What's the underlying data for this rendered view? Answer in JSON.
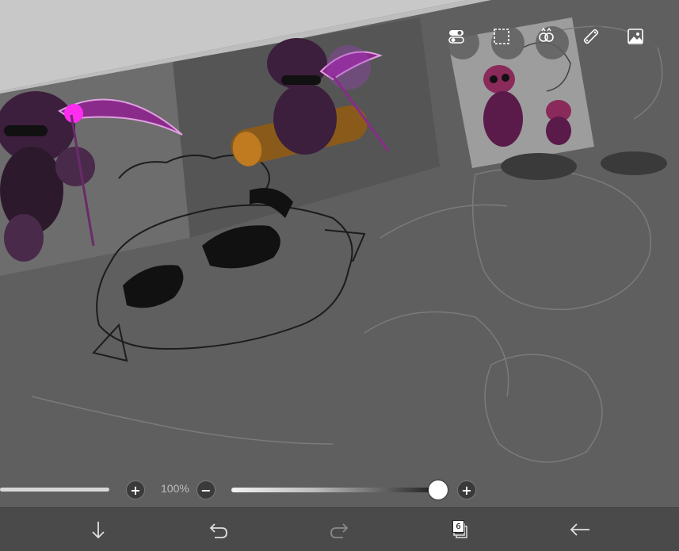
{
  "zoom": {
    "label": "100%"
  },
  "layers": {
    "count": "6"
  },
  "colors": {
    "toolbar_bg": "#4a4a4a",
    "canvas_bg": "#5e5e5e",
    "outer_bg": "#c8c8c8",
    "accent_purple": "#8a2a8a"
  },
  "toolbar_top": {
    "icons": [
      "toggle-icon",
      "selection-icon",
      "filter-icon",
      "ruler-icon",
      "image-icon"
    ]
  },
  "bottom_bar": {
    "icons": [
      "download-icon",
      "undo-icon",
      "redo-icon",
      "layers-icon",
      "back-icon"
    ]
  },
  "brush": {
    "opacity_level": 0.9
  }
}
